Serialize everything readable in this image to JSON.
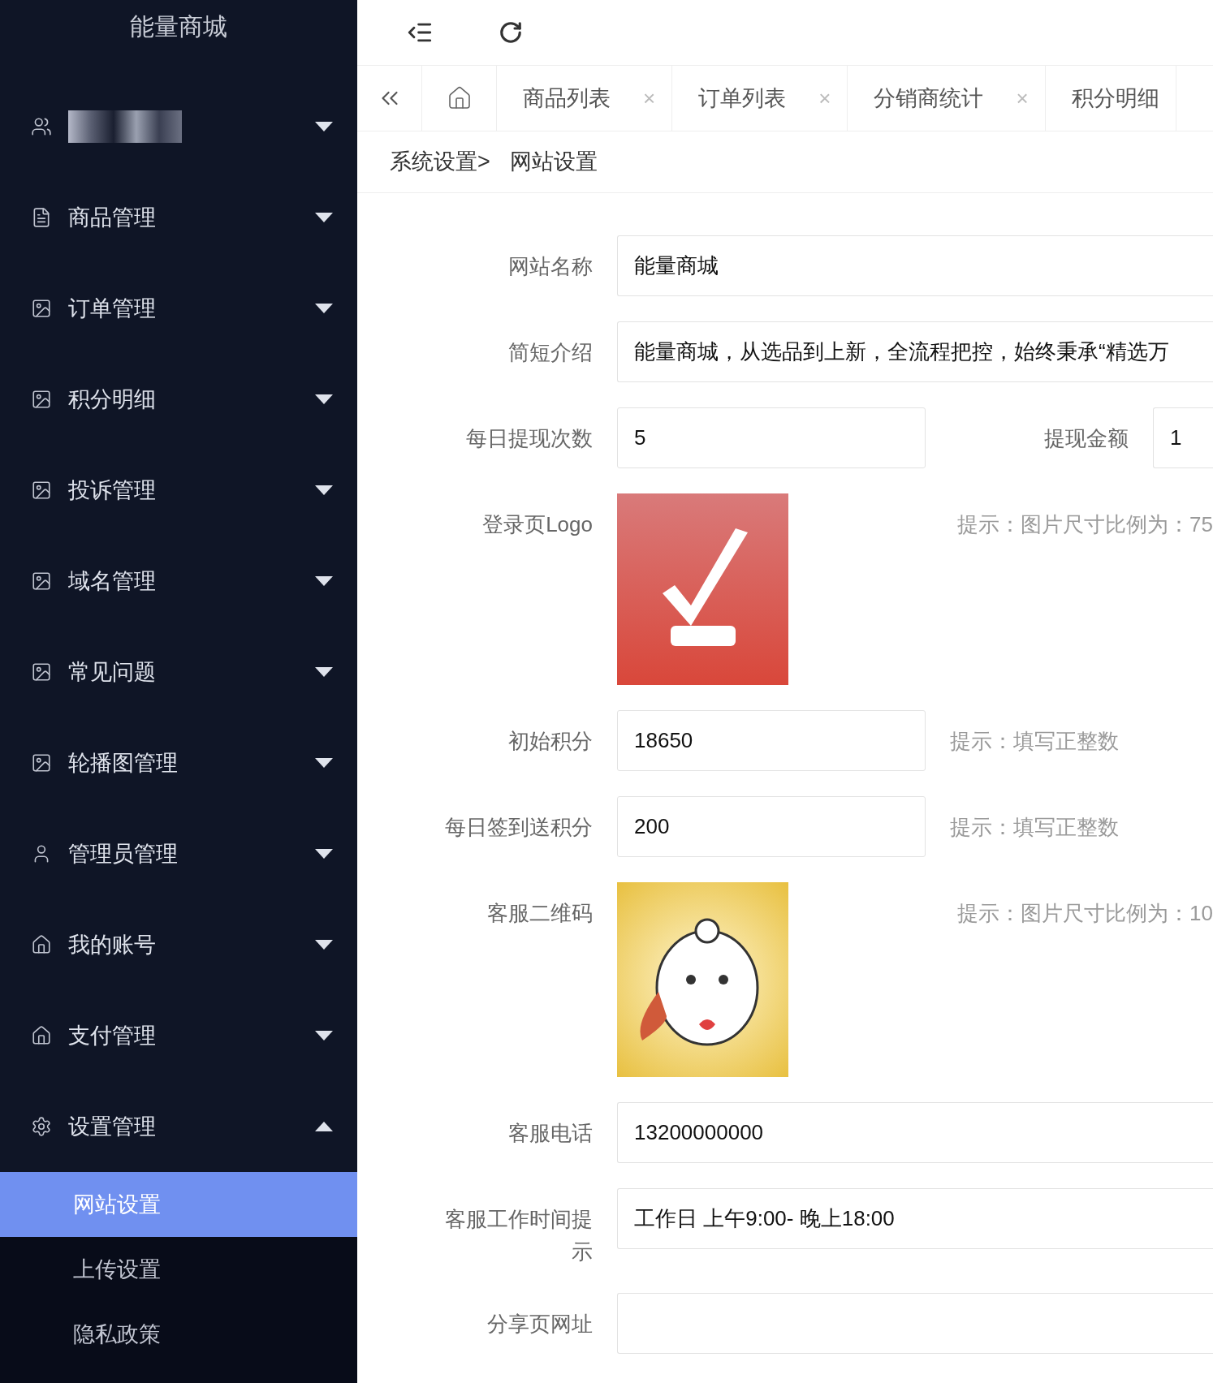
{
  "sidebar": {
    "title": "能量商城",
    "items": [
      {
        "kind": "account",
        "expanded": false
      },
      {
        "kind": "menu",
        "label": "商品管理",
        "expanded": false
      },
      {
        "kind": "menu",
        "label": "订单管理",
        "expanded": false
      },
      {
        "kind": "menu",
        "label": "积分明细",
        "expanded": false
      },
      {
        "kind": "menu",
        "label": "投诉管理",
        "expanded": false
      },
      {
        "kind": "menu",
        "label": "域名管理",
        "expanded": false
      },
      {
        "kind": "menu",
        "label": "常见问题",
        "expanded": false
      },
      {
        "kind": "menu",
        "label": "轮播图管理",
        "expanded": false
      },
      {
        "kind": "menu",
        "label": "管理员管理",
        "expanded": false
      },
      {
        "kind": "menu",
        "label": "我的账号",
        "expanded": false
      },
      {
        "kind": "menu",
        "label": "支付管理",
        "expanded": false
      },
      {
        "kind": "menu",
        "label": "设置管理",
        "expanded": true,
        "children": [
          {
            "label": "网站设置",
            "selected": true
          },
          {
            "label": "上传设置",
            "selected": false
          },
          {
            "label": "隐私政策",
            "selected": false
          }
        ]
      }
    ]
  },
  "tabs": [
    {
      "kind": "home"
    },
    {
      "kind": "page",
      "label": "商品列表",
      "close": "×"
    },
    {
      "kind": "page",
      "label": "订单列表",
      "close": "×"
    },
    {
      "kind": "page",
      "label": "分销商统计",
      "close": "×"
    },
    {
      "kind": "page",
      "label": "积分明细"
    }
  ],
  "breadcrumb": [
    "系统设置>",
    "网站设置"
  ],
  "form": [
    {
      "kind": "input",
      "label": "网站名称",
      "value": "能量商城"
    },
    {
      "kind": "input",
      "label": "简短介绍",
      "value": "能量商城，从选品到上新，全流程把控，始终秉承“精选万"
    },
    {
      "kind": "pair",
      "label": "每日提现次数",
      "value": "5",
      "label2": "提现金额",
      "value2": "1"
    },
    {
      "kind": "image",
      "label": "登录页Logo",
      "hint": "提示：图片尺寸比例为：75"
    },
    {
      "kind": "input",
      "label": "初始积分",
      "value": "18650",
      "hint": "提示：填写正整数"
    },
    {
      "kind": "input",
      "label": "每日签到送积分",
      "value": "200",
      "hint": "提示：填写正整数"
    },
    {
      "kind": "image",
      "label": "客服二维码",
      "hint": "提示：图片尺寸比例为：10"
    },
    {
      "kind": "input",
      "label": "客服电话",
      "value": "13200000000"
    },
    {
      "kind": "input",
      "label": "客服工作时间提示",
      "value": "工作日 上午9:00- 晚上18:00"
    },
    {
      "kind": "input",
      "label": "分享页网址"
    }
  ]
}
